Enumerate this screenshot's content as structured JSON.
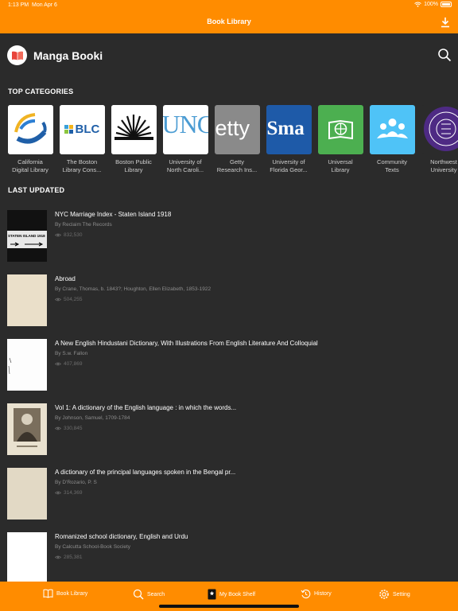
{
  "status_bar": {
    "time": "1:13 PM",
    "date": "Mon Apr 6",
    "battery": "100%"
  },
  "nav": {
    "title": "Book Library",
    "download_icon": "download-icon"
  },
  "header": {
    "app_name": "Manga Booki",
    "search_icon": "search-icon"
  },
  "sections": {
    "top_categories": "TOP CATEGORIES",
    "last_updated": "LAST UPDATED"
  },
  "categories": [
    {
      "label": "California\nDigital Library",
      "thumb_text": ""
    },
    {
      "label": "The Boston\nLibrary Cons...",
      "thumb_text": "BLC"
    },
    {
      "label": "Boston Public\nLibrary",
      "thumb_text": ""
    },
    {
      "label": "University of\nNorth Caroli...",
      "thumb_text": "UNC"
    },
    {
      "label": "Getty\nResearch Ins...",
      "thumb_text": "etty"
    },
    {
      "label": "University of\nFlorida Geor...",
      "thumb_text": "Sma"
    },
    {
      "label": "Universal\nLibrary",
      "thumb_text": ""
    },
    {
      "label": "Community\nTexts",
      "thumb_text": ""
    },
    {
      "label": "Northwest\nUniversity",
      "thumb_text": ""
    }
  ],
  "books": [
    {
      "title": "NYC Marriage Index - Staten Island 1918",
      "author": "By Reclaim The Records",
      "views": "832,530",
      "cover_text": "STATEN ISLAND 1918"
    },
    {
      "title": "Abroad",
      "author": "By Crane, Thomas, b. 1843?; Houghton, Ellen Elizabeth, 1853-1922",
      "views": "504,255",
      "cover_text": ""
    },
    {
      "title": "A New English Hindustani Dictionary, With Illustrations From English Literature And Colloquial",
      "author": "By  S.w. Fallon",
      "views": "407,869",
      "cover_text": ""
    },
    {
      "title": "Vol 1: A dictionary of the English language : in which the words...",
      "author": "By Johnson, Samuel, 1709-1784",
      "views": "330,845",
      "cover_text": ""
    },
    {
      "title": "A dictionary of the principal languages spoken in the Bengal pr...",
      "author": "By D'Rozario, P. S",
      "views": "314,369",
      "cover_text": ""
    },
    {
      "title": "Romanized school dictionary, English and Urdu",
      "author": "By Calcutta School-Book Society",
      "views": "285,381",
      "cover_text": ""
    }
  ],
  "tabs": [
    {
      "label": "Book Library",
      "icon": "book-icon"
    },
    {
      "label": "Search",
      "icon": "search-icon"
    },
    {
      "label": "My Book Shelf",
      "icon": "bookmark-icon"
    },
    {
      "label": "History",
      "icon": "history-icon"
    },
    {
      "label": "Setting",
      "icon": "gear-icon"
    }
  ],
  "colors": {
    "accent": "#ff8c00",
    "background": "#2b2b2b",
    "muted_text": "#8d8d8d"
  }
}
